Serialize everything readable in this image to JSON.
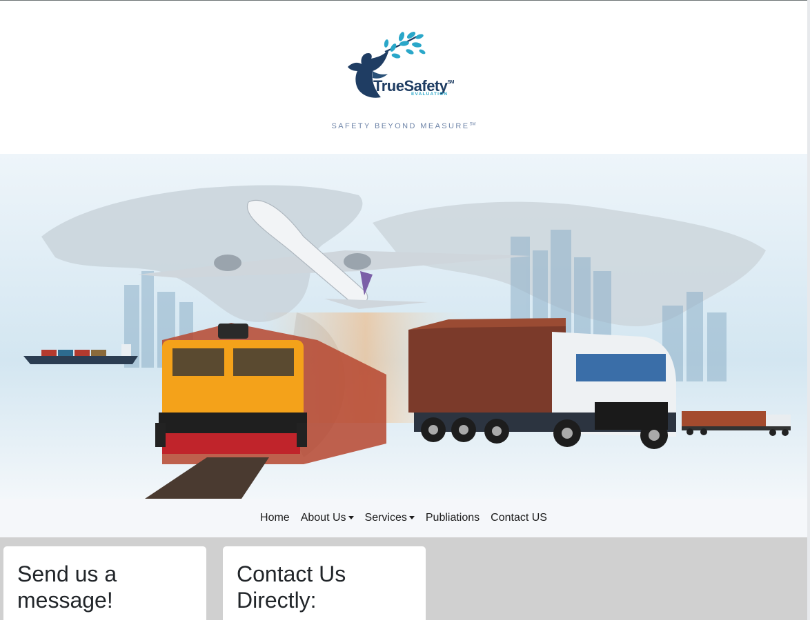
{
  "header": {
    "brand_name": "TrueSafety",
    "brand_mark": "SM",
    "brand_sub": "EVALUATION",
    "tagline": "SAFETY BEYOND MEASURE",
    "tagline_mark": "SM"
  },
  "icons": {
    "logo": "dove-with-leaves-logo"
  },
  "colors": {
    "brand_navy": "#1f3d63",
    "brand_teal": "#2aa7c9",
    "nav_background": "#f5f7fa",
    "content_background": "#d0d0d0"
  },
  "nav": {
    "items": [
      {
        "label": "Home"
      },
      {
        "label": "About Us",
        "dropdown": true
      },
      {
        "label": "Services",
        "dropdown": true
      },
      {
        "label": "Publiations"
      },
      {
        "label": "Contact US"
      }
    ]
  },
  "cards": [
    {
      "heading_line1": "Send us a",
      "heading_line2": "message!"
    },
    {
      "heading_line1": "Contact Us",
      "heading_line2": "Directly:"
    }
  ]
}
